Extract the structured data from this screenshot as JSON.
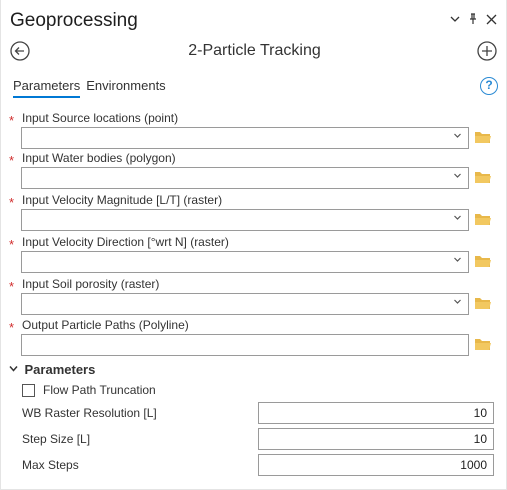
{
  "pane": {
    "title": "Geoprocessing",
    "controls": {
      "options_icon": "chevron-down-icon",
      "pin_icon": "pin-icon",
      "close_icon": "close-icon"
    }
  },
  "tool": {
    "name": "2-Particle Tracking",
    "back_icon": "back-arrow-icon",
    "add_icon": "add-icon"
  },
  "tabs": [
    {
      "label": "Parameters",
      "active": true
    },
    {
      "label": "Environments",
      "active": false
    }
  ],
  "help_label": "?",
  "required_marker": "*",
  "inputs": [
    {
      "label": "Input Source locations (point)",
      "value": "",
      "dropdown": true
    },
    {
      "label": "Input Water bodies (polygon)",
      "value": "",
      "dropdown": true
    },
    {
      "label": "Input Velocity Magnitude [L/T] (raster)",
      "value": "",
      "dropdown": true
    },
    {
      "label": "Input Velocity Direction [°wrt N] (raster)",
      "value": "",
      "dropdown": true
    },
    {
      "label": "Input Soil porosity (raster)",
      "value": "",
      "dropdown": true
    },
    {
      "label": "Output Particle Paths (Polyline)",
      "value": "",
      "dropdown": false
    }
  ],
  "parameters_section": {
    "label": "Parameters",
    "expanded": true,
    "checkbox": {
      "label": "Flow Path Truncation",
      "checked": false
    },
    "numeric": [
      {
        "label": "WB Raster Resolution [L]",
        "value": "10"
      },
      {
        "label": "Step Size [L]",
        "value": "10"
      },
      {
        "label": "Max Steps",
        "value": "1000"
      }
    ]
  },
  "colors": {
    "accent": "#0078d4",
    "required": "#d12c2c",
    "folder": "#e8b84a",
    "help": "#2a8ad4"
  }
}
